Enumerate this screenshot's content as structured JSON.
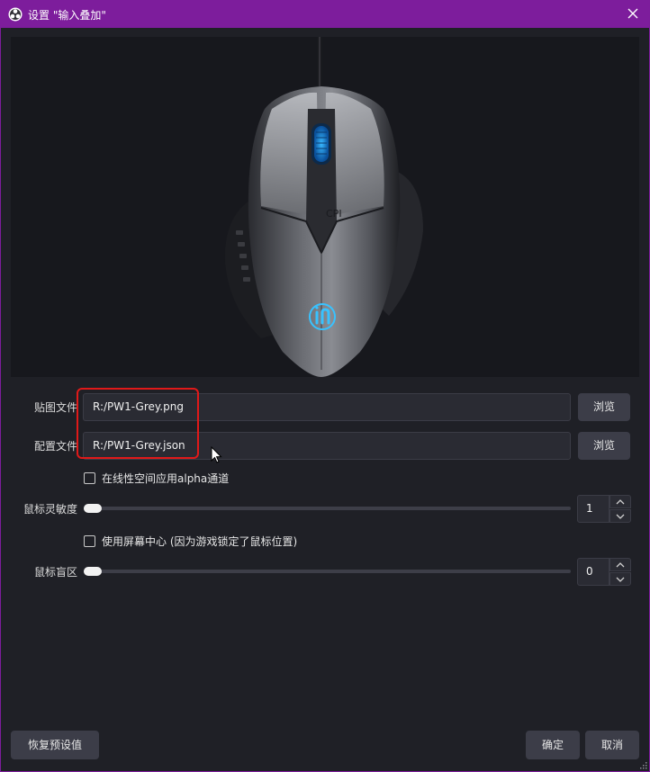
{
  "window": {
    "title": "设置 \"输入叠加\"",
    "app_icon": "obs-logo-icon",
    "close_icon": "close-icon"
  },
  "preview": {
    "image": "gaming-mouse-preview",
    "logo_text": "iN",
    "accent_color": "#1ea0ff"
  },
  "texture_file": {
    "label": "贴图文件",
    "value": "R:/PW1-Grey.png",
    "browse_label": "浏览"
  },
  "config_file": {
    "label": "配置文件",
    "value": "R:/PW1-Grey.json",
    "browse_label": "浏览"
  },
  "linear_alpha": {
    "label": "在线性空间应用alpha通道",
    "checked": false
  },
  "mouse_sensitivity": {
    "label": "鼠标灵敏度",
    "value": "1",
    "level": 0
  },
  "screen_center": {
    "label": "使用屏幕中心 (因为游戏锁定了鼠标位置)",
    "checked": false
  },
  "mouse_deadzone": {
    "label": "鼠标盲区",
    "value": "0",
    "level": 0
  },
  "footer": {
    "restore_defaults_label": "恢复预设值",
    "ok_label": "确定",
    "cancel_label": "取消"
  },
  "colors": {
    "titlebar": "#7d1d9c",
    "background": "#1f2026",
    "annotation_box": "#e01919"
  }
}
